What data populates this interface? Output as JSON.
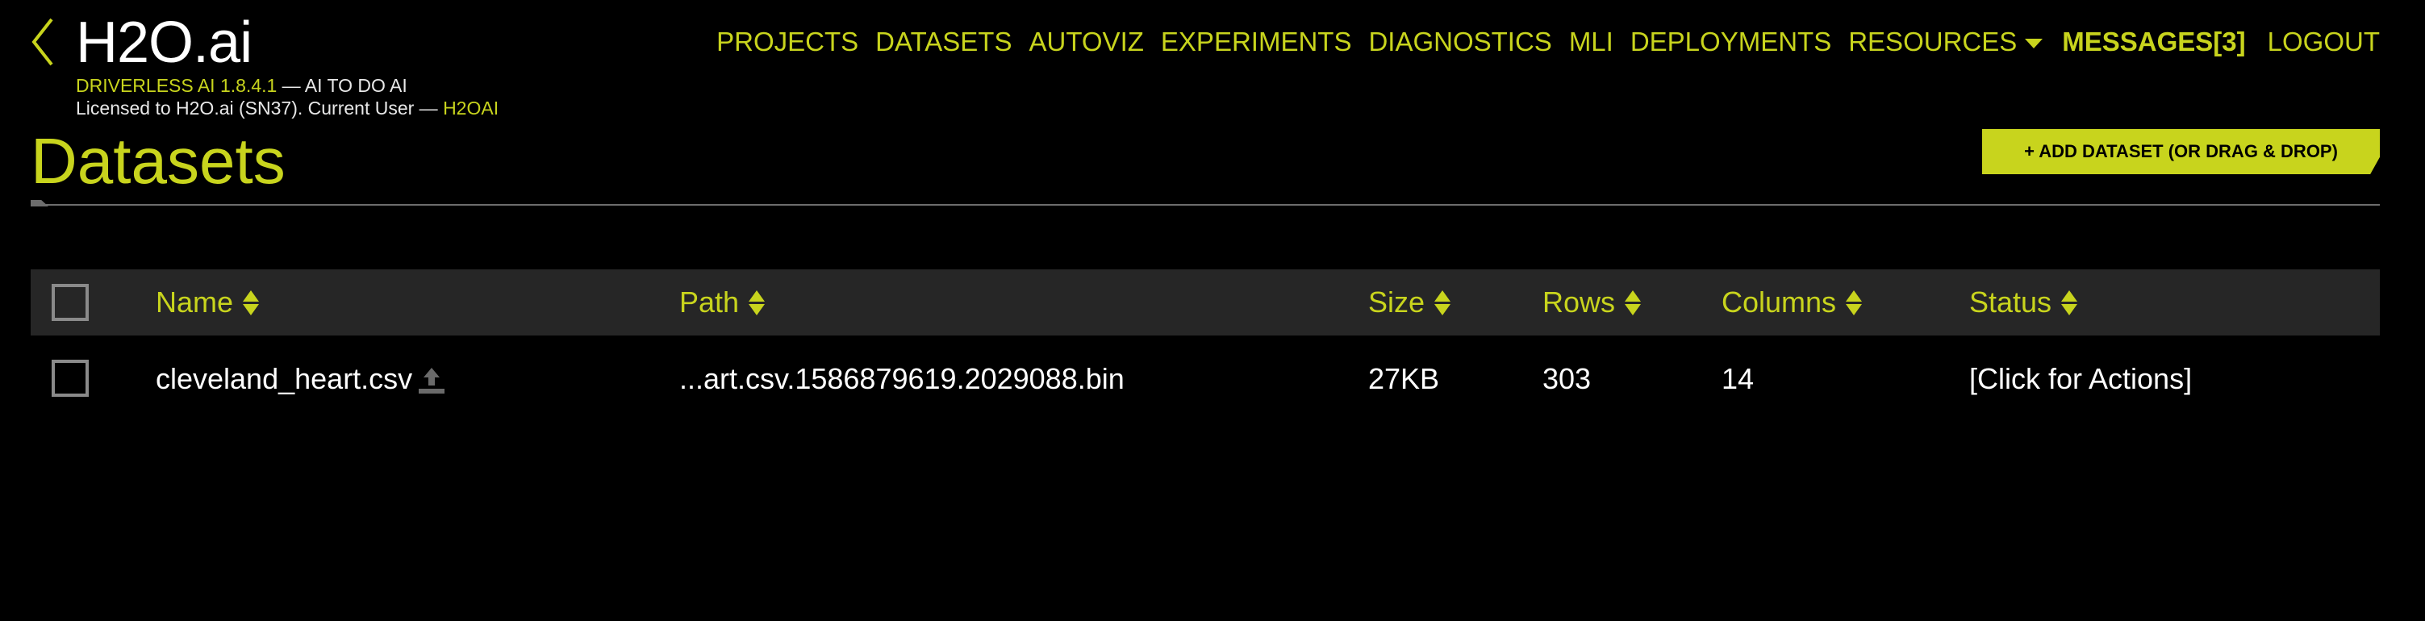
{
  "app": {
    "brand": "H2O.ai",
    "product_name": "DRIVERLESS AI 1.8.4.1",
    "tagline": " — AI TO DO AI",
    "license_text": "Licensed to H2O.ai (SN37). Current User — ",
    "current_user": "H2OAI"
  },
  "nav": {
    "items": [
      {
        "label": "PROJECTS"
      },
      {
        "label": "DATASETS"
      },
      {
        "label": "AUTOVIZ"
      },
      {
        "label": "EXPERIMENTS"
      },
      {
        "label": "DIAGNOSTICS"
      },
      {
        "label": "MLI"
      },
      {
        "label": "DEPLOYMENTS"
      },
      {
        "label": "RESOURCES"
      }
    ],
    "messages_label": "MESSAGES[3]",
    "logout_label": "LOGOUT"
  },
  "page": {
    "title": "Datasets",
    "add_dataset_label": "+ ADD DATASET (OR DRAG & DROP)"
  },
  "table": {
    "columns": [
      "Name",
      "Path",
      "Size",
      "Rows",
      "Columns",
      "Status"
    ],
    "rows": [
      {
        "name": "cleveland_heart.csv",
        "path": "...art.csv.1586879619.2029088.bin",
        "size": "27KB",
        "rows": "303",
        "columns": "14",
        "status": "[Click for Actions]"
      }
    ]
  },
  "colors": {
    "accent": "#c8d41d",
    "background": "#000000",
    "header_row": "#262626"
  },
  "icons": {
    "back": "chevron-left-icon",
    "dropdown": "caret-down-icon",
    "sort": "sort-icon",
    "upload": "upload-icon"
  }
}
